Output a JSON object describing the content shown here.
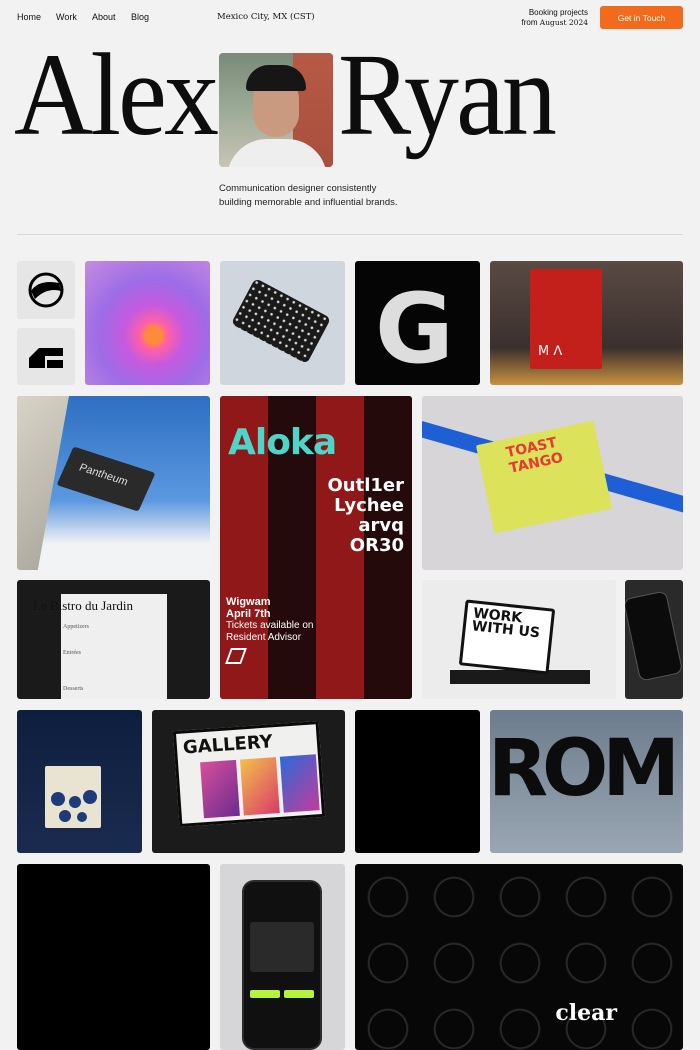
{
  "nav": {
    "home": "Home",
    "work": "Work",
    "about": "About",
    "blog": "Blog",
    "location": "Mexico City, MX (CST)",
    "booking_line1": "Booking projects",
    "booking_from": "from",
    "booking_date": "August 2024",
    "cta": "Get in Touch"
  },
  "hero": {
    "first_name": "Alex",
    "last_name": "Ryan",
    "tagline_line1": "Communication designer consistently",
    "tagline_line2": "building memorable and influential brands."
  },
  "projects": {
    "aloka_title": "Aloka",
    "aloka_line1": "Outl1er",
    "aloka_line2": "Lychee",
    "aloka_line3": "arvq",
    "aloka_line4": "OR30",
    "aloka_event1": "Wigwam",
    "aloka_event2": "April 7th",
    "aloka_tix1": "Tickets available on",
    "aloka_tix2": "Resident Advisor",
    "bistro_title": "Le Bistro du Jardin",
    "bistro_s1": "Appetizers",
    "bistro_s2": "Entrées",
    "bistro_s3": "Desserts",
    "pantheum": "Pantheum",
    "toast": "TOAST TANGO",
    "work": "WORK WITH US",
    "gallery": "GALLERY",
    "rom": "ROM",
    "clear": "clear"
  },
  "colors": {
    "accent": "#f26a1b",
    "background": "#f2f2f2"
  }
}
